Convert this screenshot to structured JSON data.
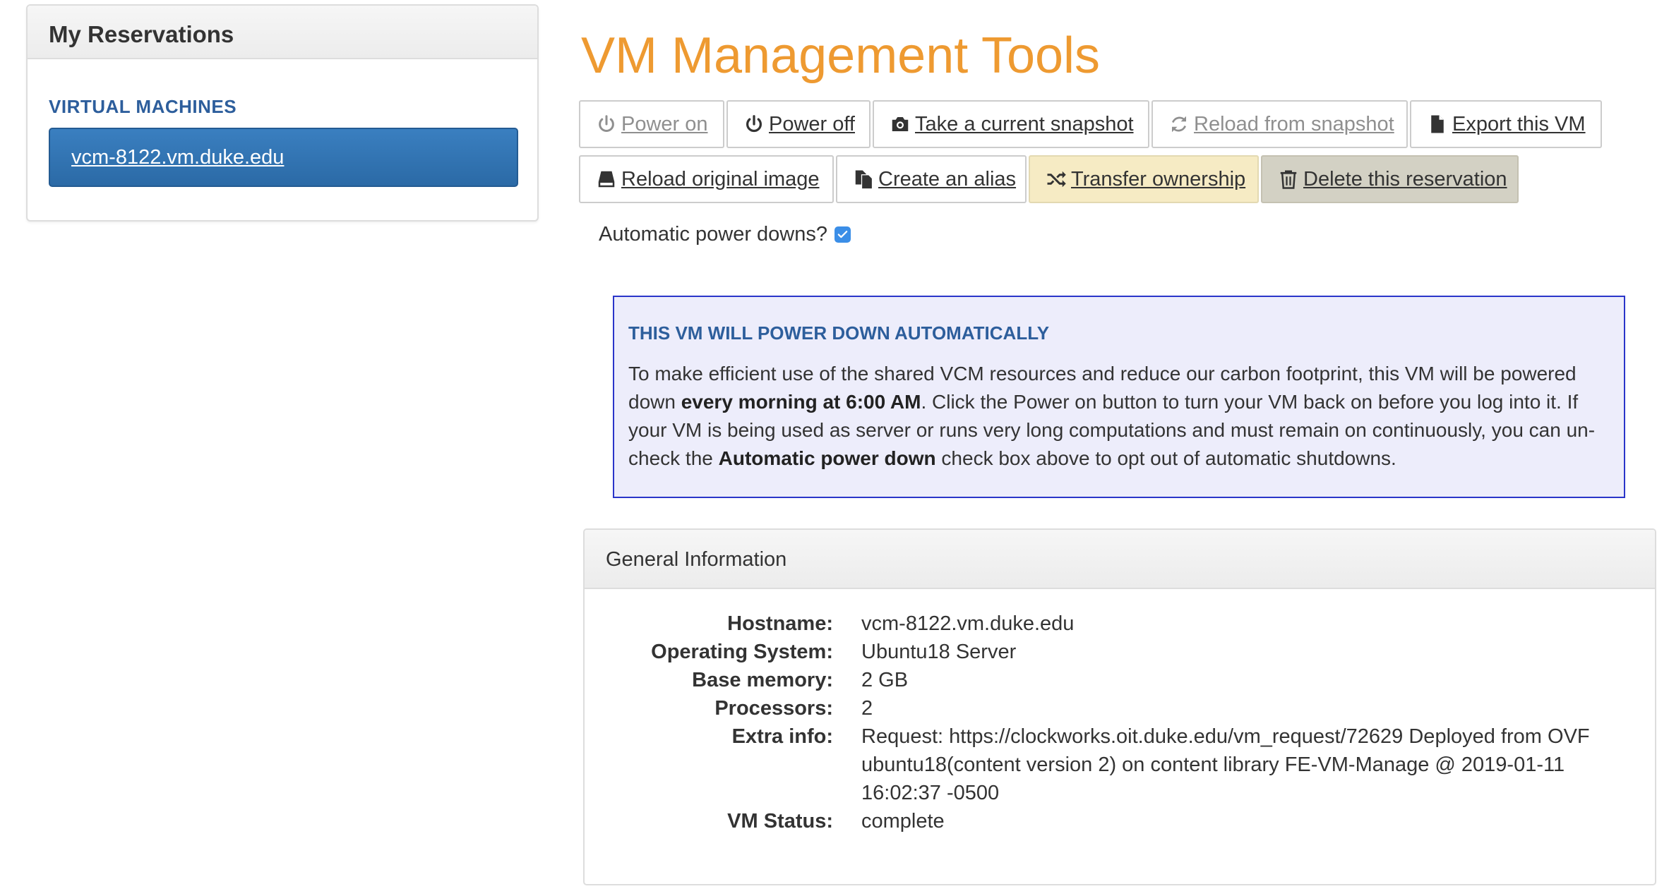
{
  "sidebar": {
    "title": "My Reservations",
    "section_label": "VIRTUAL MACHINES",
    "vm_link": "vcm-8122.vm.duke.edu"
  },
  "main": {
    "title": "VM Management Tools",
    "buttons": {
      "power_on": "Power on",
      "power_off": "Power off",
      "snapshot": "Take a current snapshot",
      "reload_snapshot": "Reload from snapshot",
      "export": "Export this VM",
      "reload_image": "Reload original image",
      "alias": "Create an alias",
      "transfer": "Transfer ownership",
      "delete": "Delete this reservation"
    },
    "autopower": {
      "label": "Automatic power downs?",
      "checked": true
    },
    "notice": {
      "heading": "THIS VM WILL POWER DOWN AUTOMATICALLY",
      "text_1": "To make efficient use of the shared VCM resources and reduce our carbon footprint, this VM will be powered down ",
      "bold_1": "every morning at 6:00 AM",
      "text_2": ". Click the Power on button to turn your VM back on before you log into it. If your VM is being used as server or runs very long computations and must remain on continuously, you can un-check the ",
      "bold_2": "Automatic power down",
      "text_3": " check box above to opt out of automatic shutdowns."
    },
    "general_info": {
      "title": "General Information",
      "rows": [
        {
          "label": "Hostname:",
          "value": "vcm-8122.vm.duke.edu"
        },
        {
          "label": "Operating System:",
          "value": "Ubuntu18 Server"
        },
        {
          "label": "Base memory:",
          "value": "2 GB"
        },
        {
          "label": "Processors:",
          "value": "2"
        },
        {
          "label": "Extra info:",
          "value": "Request: https://clockworks.oit.duke.edu/vm_request/72629 Deployed from OVF ubuntu18(content version 2) on content library FE-VM-Manage @ 2019-01-11 16:02:37 -0500"
        },
        {
          "label": "VM Status:",
          "value": "complete"
        }
      ]
    }
  },
  "colors": {
    "title_orange": "#ee9a31",
    "heading_blue": "#2d5e9c",
    "vm_button_blue": "#3276b1",
    "notice_border": "#2a35c9",
    "notice_bg": "#ededfb",
    "transfer_bg": "#f6ebc4",
    "delete_bg": "#d3d1c4"
  },
  "icons": {
    "power_on": "power-icon",
    "power_off": "power-icon",
    "snapshot": "camera-icon",
    "reload_snapshot": "refresh-icon",
    "export": "file-icon",
    "reload_image": "hdd-icon",
    "alias": "copy-files-icon",
    "transfer": "shuffle-icon",
    "delete": "trash-icon"
  }
}
